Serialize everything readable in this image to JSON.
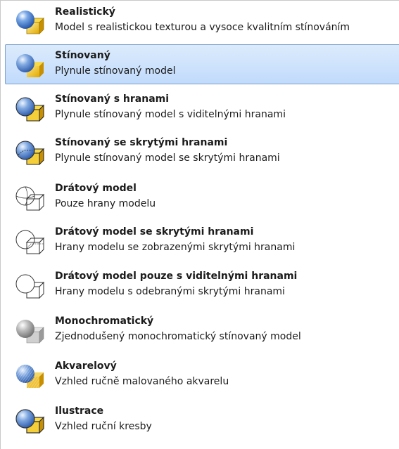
{
  "menu": {
    "items": [
      {
        "title": "Realistický",
        "desc": "Model s realistickou texturou a vysoce kvalitním stínováním",
        "icon": "visual-style-realistic-icon"
      },
      {
        "title": "Stínovaný",
        "desc": "Plynule stínovaný model",
        "icon": "visual-style-shaded-icon",
        "selected": true
      },
      {
        "title": "Stínovaný s hranami",
        "desc": "Plynule stínovaný model s viditelnými hranami",
        "icon": "visual-style-shaded-edges-icon"
      },
      {
        "title": "Stínovaný se skrytými hranami",
        "desc": "Plynule stínovaný model se skrytými hranami",
        "icon": "visual-style-shaded-hidden-edges-icon"
      },
      {
        "title": "Drátový model",
        "desc": "Pouze hrany modelu",
        "icon": "visual-style-wireframe-icon"
      },
      {
        "title": "Drátový model se skrytými hranami",
        "desc": "Hrany modelu se zobrazenými skrytými hranami",
        "icon": "visual-style-wireframe-hidden-edges-icon"
      },
      {
        "title": "Drátový model pouze s viditelnými hranami",
        "desc": "Hrany modelu s odebranými skrytými hranami",
        "icon": "visual-style-wireframe-visible-only-icon"
      },
      {
        "title": "Monochromatický",
        "desc": "Zjednodušený monochromatický stínovaný model",
        "icon": "visual-style-monochrome-icon"
      },
      {
        "title": "Akvarelový",
        "desc": "Vzhled ručně malovaného akvarelu",
        "icon": "visual-style-watercolor-icon"
      },
      {
        "title": "Ilustrace",
        "desc": "Vzhled ruční kresby",
        "icon": "visual-style-illustration-icon"
      }
    ]
  },
  "colors": {
    "selection_fill": "#c6ddfb",
    "selection_border": "#7da2ce",
    "text": "#1b1b1b"
  }
}
